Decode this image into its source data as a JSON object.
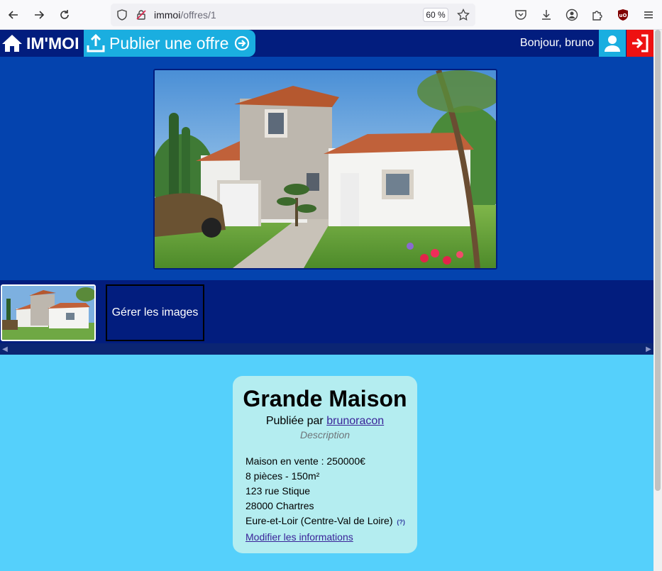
{
  "browser": {
    "url_host": "immoi",
    "url_path": "/offres/1",
    "zoom": "60 %"
  },
  "header": {
    "brand": "IM'MOI",
    "publish_label": "Publier une offre",
    "greeting": "Bonjour, bruno"
  },
  "gallery": {
    "manage_label": "Gérer les images"
  },
  "offer": {
    "title": "Grande Maison",
    "published_by": "Publiée par",
    "author": "brunoracon",
    "description": "Description",
    "price_line": "Maison en vente : 250000€",
    "rooms_line": "8 pièces - 150m²",
    "address": "123 rue Stique",
    "city": "28000 Chartres",
    "region": "Eure-et-Loir (Centre-Val de Loire)",
    "help": "(?)",
    "modify_label": "Modifier les informations"
  },
  "colors": {
    "header_bg": "#021d7e",
    "hero_bg": "#0443ae",
    "page_bg": "#55d0fb",
    "accent": "#1aaee0",
    "logout": "#ee1111",
    "card_bg": "#b4edf0"
  }
}
